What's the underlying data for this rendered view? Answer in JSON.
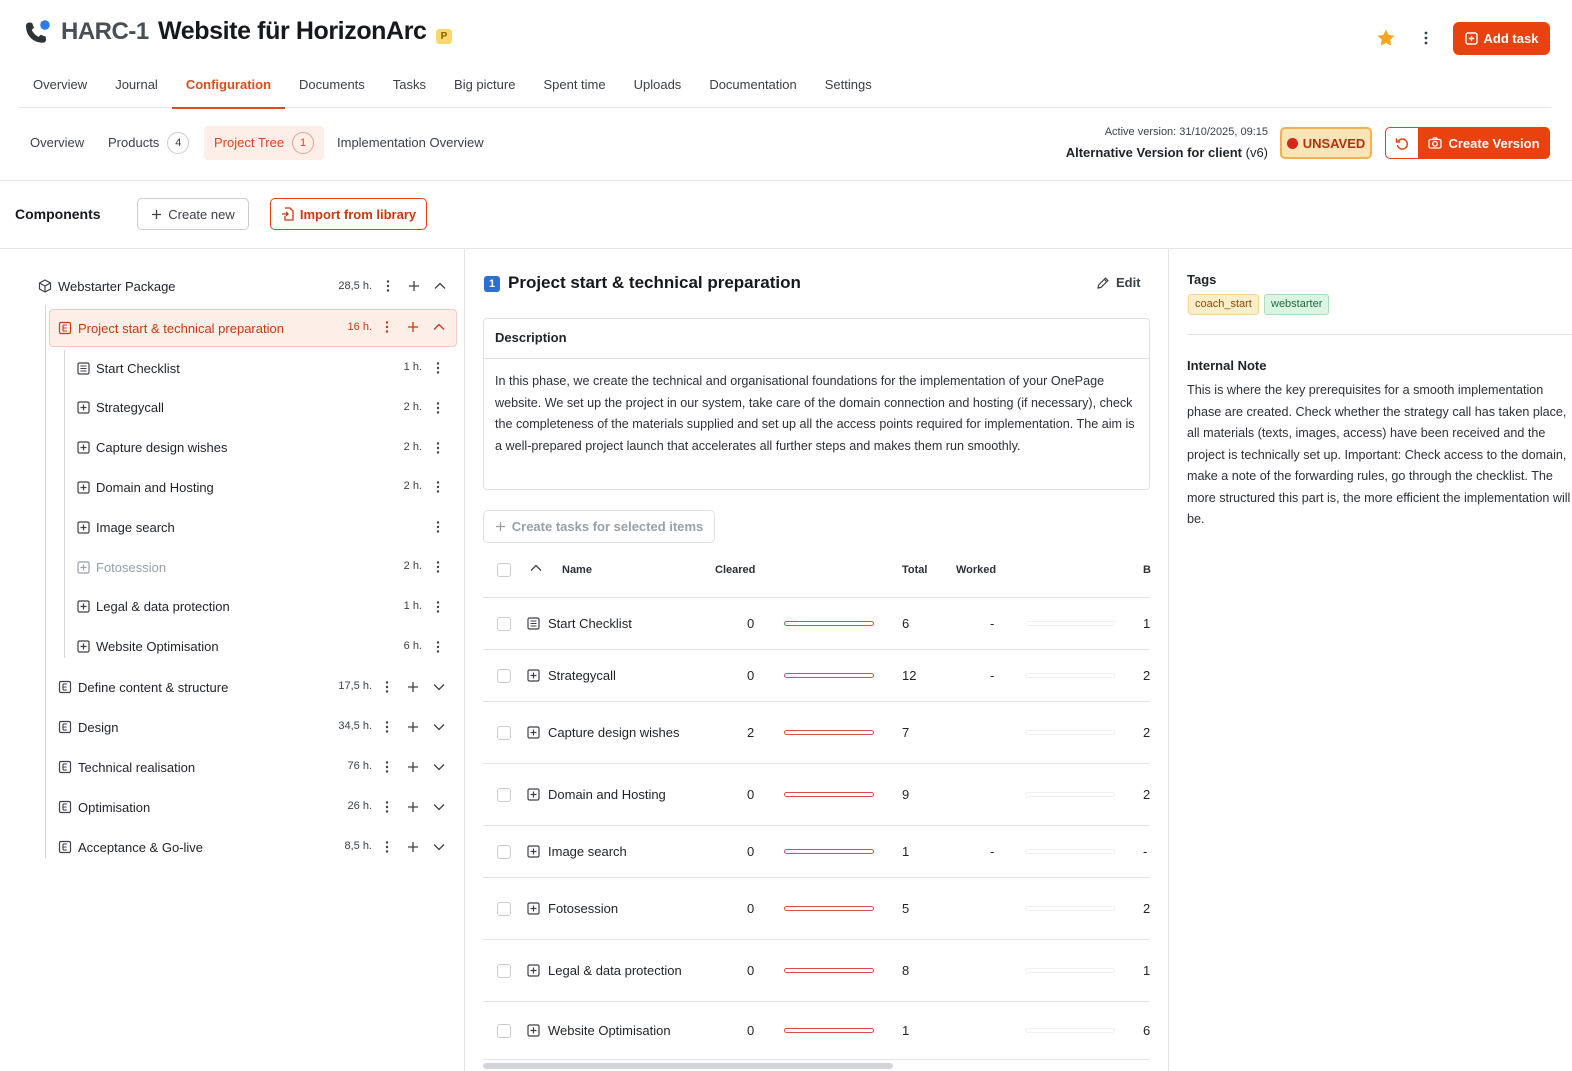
{
  "header": {
    "project_code": "HARC-1",
    "project_title": "Website für HorizonArc",
    "priority_badge": "P",
    "add_task_label": "Add task"
  },
  "main_tabs": [
    "Overview",
    "Journal",
    "Configuration",
    "Documents",
    "Tasks",
    "Big picture",
    "Spent time",
    "Uploads",
    "Documentation",
    "Settings"
  ],
  "sub_tabs": [
    {
      "label": "Overview",
      "count": ""
    },
    {
      "label": "Products",
      "count": "4"
    },
    {
      "label": "Project Tree",
      "count": "1"
    },
    {
      "label": "Implementation Overview",
      "count": ""
    }
  ],
  "version": {
    "active_label": "Active version:",
    "active_value": "31/10/2025, 09:15",
    "alt_name": "Alternative Version for client",
    "alt_tag": "(v6)",
    "unsaved_label": "UNSAVED",
    "create_version_label": "Create Version"
  },
  "components": {
    "title": "Components",
    "create_new_label": "Create new",
    "import_label": "Import from library"
  },
  "tree": {
    "root": {
      "label": "Webstarter Package",
      "hours": "28,5 h."
    },
    "selected": {
      "label": "Project start & technical preparation",
      "hours": "16 h."
    },
    "children": [
      {
        "label": "Start Checklist",
        "hours": "1 h.",
        "icon": "checklist-icon"
      },
      {
        "label": "Strategycall",
        "hours": "2 h.",
        "icon": "plus-box-icon"
      },
      {
        "label": "Capture design wishes",
        "hours": "2 h.",
        "icon": "plus-box-icon"
      },
      {
        "label": "Domain and Hosting",
        "hours": "2 h.",
        "icon": "plus-box-icon"
      },
      {
        "label": "Image search",
        "hours": "",
        "icon": "plus-box-icon"
      },
      {
        "label": "Fotosession",
        "hours": "2 h.",
        "icon": "plus-box-icon",
        "muted": true
      },
      {
        "label": "Legal & data protection",
        "hours": "1 h.",
        "icon": "plus-box-icon"
      },
      {
        "label": "Website Optimisation",
        "hours": "6 h.",
        "icon": "plus-box-icon"
      }
    ],
    "sections": [
      {
        "label": "Define content & structure",
        "hours": "17,5 h."
      },
      {
        "label": "Design",
        "hours": "34,5 h."
      },
      {
        "label": "Technical realisation",
        "hours": "76 h."
      },
      {
        "label": "Optimisation",
        "hours": "26 h."
      },
      {
        "label": "Acceptance & Go-live",
        "hours": "8,5 h."
      }
    ]
  },
  "detail": {
    "number": "1",
    "title": "Project start & technical preparation",
    "edit_label": "Edit",
    "description_header": "Description",
    "description": "In this phase, we create the technical and organisational foundations for the implementation of your OnePage website. We set up the project in our system, take care of the domain connection and hosting (if necessary), check the completeness of the materials supplied and set up all the access points required for implementation. The aim is a well-prepared project launch that accelerates all further steps and makes them run smoothly.",
    "create_tasks_label": "Create tasks for selected items",
    "table": {
      "headers": {
        "name": "Name",
        "cleared": "Cleared",
        "total": "Total",
        "worked": "Worked",
        "b": "B"
      },
      "rows": [
        {
          "name": "Start Checklist",
          "cleared": "0",
          "total": "6",
          "worked": "-",
          "b": "1",
          "icon": "checklist-icon"
        },
        {
          "name": "Strategycall",
          "cleared": "0",
          "total": "12",
          "worked": "-",
          "b": "2",
          "icon": "plus-box-icon"
        },
        {
          "name": "Capture design wishes",
          "cleared": "2",
          "total": "7",
          "worked": "",
          "b": "2",
          "icon": "plus-box-icon"
        },
        {
          "name": "Domain and Hosting",
          "cleared": "0",
          "total": "9",
          "worked": "",
          "b": "2",
          "icon": "plus-box-icon"
        },
        {
          "name": "Image search",
          "cleared": "0",
          "total": "1",
          "worked": "-",
          "b": "-",
          "icon": "plus-box-icon"
        },
        {
          "name": "Fotosession",
          "cleared": "0",
          "total": "5",
          "worked": "",
          "b": "2",
          "icon": "plus-box-icon"
        },
        {
          "name": "Legal & data protection",
          "cleared": "0",
          "total": "8",
          "worked": "",
          "b": "1",
          "icon": "plus-box-icon"
        },
        {
          "name": "Website Optimisation",
          "cleared": "0",
          "total": "1",
          "worked": "",
          "b": "6",
          "icon": "plus-box-icon"
        }
      ]
    }
  },
  "right_panel": {
    "tags_label": "Tags",
    "tags": [
      "coach_start",
      "webstarter"
    ],
    "note_label": "Internal Note",
    "note": "This is where the key prerequisites for a smooth implementation phase are created. Check whether the strategy call has taken place, all materials (texts, images, access) have been received and the project is technically set up. Important: Check access to the domain, make a note of the forwarding rules, go through the checklist. The more structured this part is, the more efficient the implementation will be."
  },
  "colors": {
    "accent": "#e8430f",
    "selected_bg": "#fdeee7",
    "unsaved_bg": "#fde3b8",
    "blue": "#2a6fd1"
  }
}
